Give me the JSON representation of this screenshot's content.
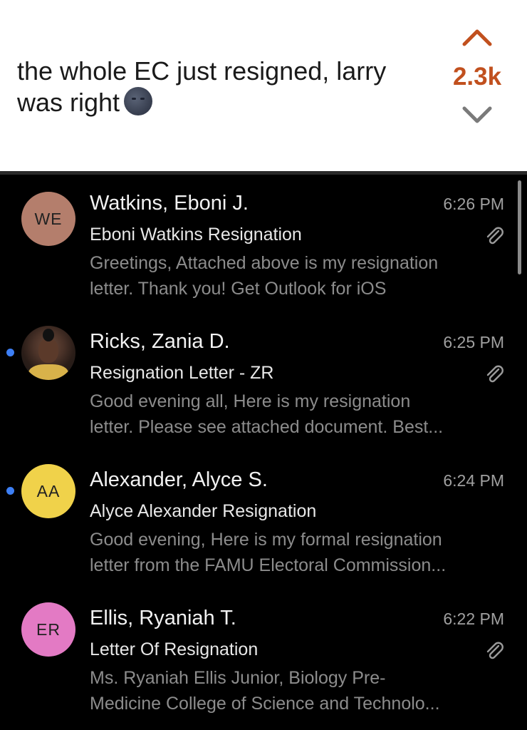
{
  "post": {
    "title": "the whole EC just resigned, larry was right",
    "vote_count": "2.3k",
    "upvote_icon": "chevron-up-icon",
    "downvote_icon": "chevron-down-icon",
    "emoji_icon": "new-moon-face-emoji",
    "upvote_color": "#c1501e"
  },
  "mail": {
    "unread_color": "#3d7ff5",
    "items": [
      {
        "initials": "WE",
        "avatar_color": "#b47e6c",
        "sender": "Watkins, Eboni J.",
        "time": "6:26 PM",
        "subject": "Eboni Watkins Resignation",
        "preview_line1": "Greetings, Attached above is my resignation",
        "preview_line2": "letter. Thank you! Get Outlook for iOS",
        "unread": false,
        "attachment": true
      },
      {
        "initials": "",
        "avatar_color": "photo",
        "sender": "Ricks, Zania D.",
        "time": "6:25 PM",
        "subject": "Resignation Letter - ZR",
        "preview_line1": "Good evening all, Here is my resignation",
        "preview_line2": "letter. Please see attached document. Best...",
        "unread": true,
        "attachment": true
      },
      {
        "initials": "AA",
        "avatar_color": "#f0d24a",
        "sender": "Alexander, Alyce S.",
        "time": "6:24 PM",
        "subject": "Alyce Alexander Resignation",
        "preview_line1": "Good evening, Here is my formal resignation",
        "preview_line2": "letter from the FAMU Electoral Commission...",
        "unread": true,
        "attachment": false
      },
      {
        "initials": "ER",
        "avatar_color": "#e37ac4",
        "sender": "Ellis, Ryaniah T.",
        "time": "6:22 PM",
        "subject": "Letter Of Resignation",
        "preview_line1": "Ms. Ryaniah Ellis Junior, Biology Pre-",
        "preview_line2": "Medicine College of Science and Technolo...",
        "unread": false,
        "attachment": true
      }
    ]
  }
}
